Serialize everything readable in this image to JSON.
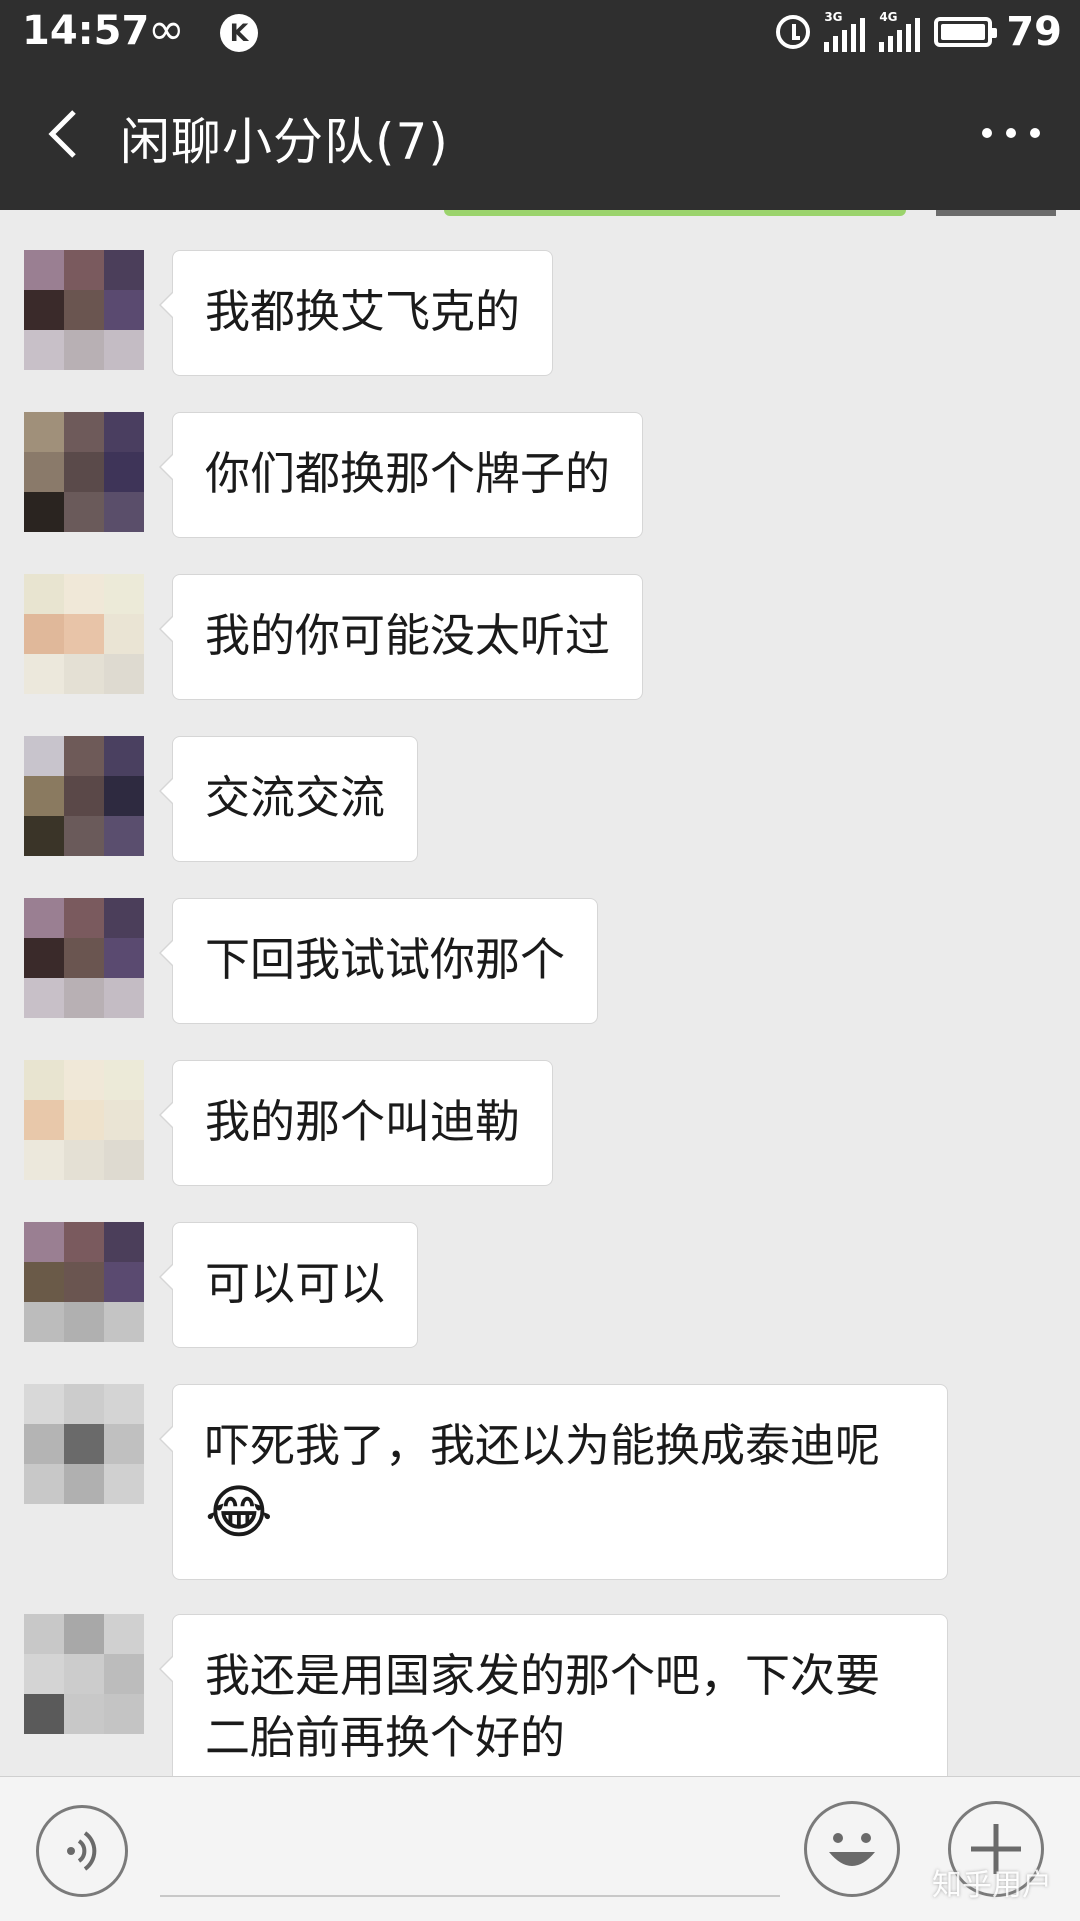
{
  "status_bar": {
    "time": "14:57",
    "loop_symbol": "∞",
    "k_badge": "K",
    "net_3g": "3G",
    "net_4g": "4G",
    "battery_level": "79",
    "icons": [
      "infinity-icon",
      "k-app-icon",
      "alarm-icon",
      "signal-3g-icon",
      "signal-4g-icon",
      "battery-icon"
    ]
  },
  "header": {
    "title": "闲聊小分队(7)"
  },
  "messages": [
    {
      "text": "我都换艾飞克的"
    },
    {
      "text": "你们都换那个牌子的"
    },
    {
      "text": "我的你可能没太听过"
    },
    {
      "text": "交流交流"
    },
    {
      "text": "下回我试试你那个"
    },
    {
      "text": "我的那个叫迪勒"
    },
    {
      "text": "可以可以"
    },
    {
      "text": "吓死我了，我还以为能换成泰迪呢",
      "emoji": "😂"
    },
    {
      "text": "我还是用国家发的那个吧，下次要二胎前再换个好的"
    }
  ],
  "colors": {
    "header_bg": "#2f2f2f",
    "chat_bg": "#ebebeb",
    "bubble_bg": "#ffffff",
    "sent_bubble": "#9bd36c"
  },
  "watermark": "知乎用户"
}
